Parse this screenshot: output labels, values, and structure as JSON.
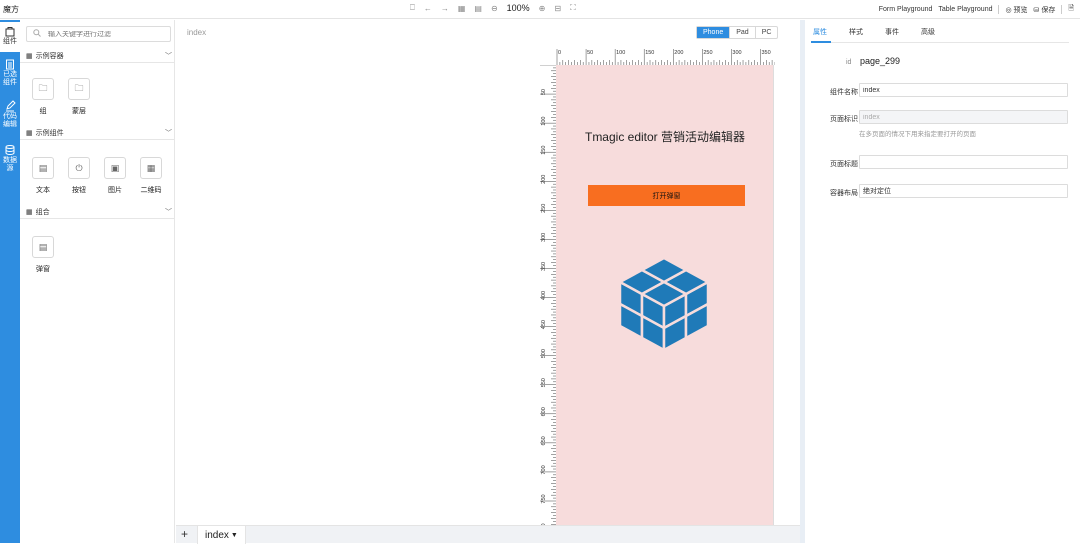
{
  "app": {
    "title": "魔方"
  },
  "toolbar": {
    "zoom": "100%",
    "icons": [
      "delete-icon",
      "undo-icon",
      "redo-icon",
      "grid-icon",
      "guides-icon",
      "zoom-out-icon",
      "zoom-in-icon",
      "fit-icon",
      "fullscreen-icon"
    ],
    "links": [
      "Form Playground",
      "Table Playground"
    ],
    "preview_label": "预览",
    "save_label": "保存"
  },
  "rail": {
    "items": [
      {
        "label": "组件",
        "icon": "bag-icon"
      },
      {
        "label": "已选组件",
        "icon": "clipboard-icon"
      },
      {
        "label": "代码编辑",
        "icon": "edit-icon"
      },
      {
        "label": "数据源",
        "icon": "database-icon"
      }
    ]
  },
  "panel": {
    "search_placeholder": "输入关键字进行过滤",
    "groups": [
      {
        "title": "示例容器",
        "items": [
          {
            "label": "组",
            "icon": "folder-icon"
          },
          {
            "label": "蒙层",
            "icon": "folder-icon"
          }
        ]
      },
      {
        "title": "示例组件",
        "items": [
          {
            "label": "文本",
            "icon": "document-icon"
          },
          {
            "label": "按钮",
            "icon": "power-icon"
          },
          {
            "label": "图片",
            "icon": "image-icon"
          },
          {
            "label": "二维码",
            "icon": "qrcode-icon"
          }
        ]
      },
      {
        "title": "组合",
        "items": [
          {
            "label": "弹窗",
            "icon": "document-icon"
          }
        ]
      }
    ]
  },
  "stage": {
    "label": "index",
    "devices": [
      "Phone",
      "Pad",
      "PC"
    ],
    "active_device": "Phone",
    "ruler_h_labels": [
      "0",
      "50",
      "100",
      "150",
      "200",
      "250",
      "300",
      "350"
    ],
    "ruler_v_labels": [
      "50",
      "100",
      "150",
      "200",
      "250",
      "300",
      "350",
      "400",
      "450",
      "500",
      "550",
      "600",
      "650",
      "700",
      "750",
      "800"
    ],
    "page_title": "Tmagic editor 营销活动编辑器",
    "button_label": "打开弹窗",
    "colors": {
      "page_bg": "#f7dcdc",
      "button": "#f86e20",
      "cube": "#1f7ab8",
      "accent": "#2e8de0"
    }
  },
  "bottom": {
    "add_label": "+",
    "tab_label": "index"
  },
  "props": {
    "tabs": [
      "属性",
      "样式",
      "事件",
      "高级"
    ],
    "active_tab": "属性",
    "id_key": "id",
    "id_value": "page_299",
    "fields": [
      {
        "label": "组件名称",
        "value": "index",
        "disabled": false,
        "hint": ""
      },
      {
        "label": "页面标识",
        "value": "index",
        "disabled": true,
        "hint": "在多页面的情况下用来指定要打开的页面"
      },
      {
        "label": "页面标题",
        "value": "",
        "disabled": false,
        "hint": ""
      },
      {
        "label": "容器布局",
        "value": "绝对定位",
        "disabled": false,
        "hint": ""
      }
    ]
  }
}
